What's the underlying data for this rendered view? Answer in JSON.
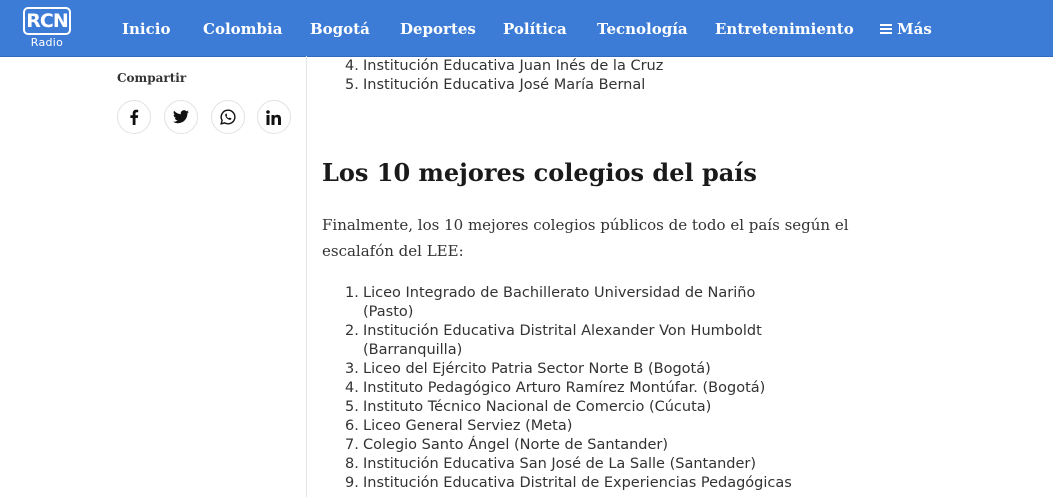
{
  "header": {
    "logo_mark": "RCN",
    "logo_text": "Radio",
    "nav": [
      {
        "label": "Inicio"
      },
      {
        "label": "Colombia"
      },
      {
        "label": "Bogotá"
      },
      {
        "label": "Deportes"
      },
      {
        "label": "Política"
      },
      {
        "label": "Tecnología"
      },
      {
        "label": "Entretenimiento"
      },
      {
        "label": "Más"
      }
    ]
  },
  "sidebar": {
    "share_label": "Compartir",
    "share_buttons": [
      "facebook-icon",
      "twitter-icon",
      "whatsapp-icon",
      "linkedin-icon"
    ]
  },
  "article": {
    "previous_list": [
      {
        "num": "4.",
        "text": "Institución Educativa Juan Inés de la Cruz"
      },
      {
        "num": "5.",
        "text": "Institución Educativa José María Bernal"
      }
    ],
    "heading": "Los 10 mejores colegios del país",
    "paragraph": "Finalmente, los 10 mejores colegios públicos de todo el país según el escalafón del LEE:",
    "top10": [
      {
        "num": "1.",
        "line1": "Liceo Integrado de Bachillerato Universidad de Nariño",
        "line2": "(Pasto)"
      },
      {
        "num": "2.",
        "line1": "Institución Educativa Distrital Alexander Von Humboldt",
        "line2": "(Barranquilla)"
      },
      {
        "num": "3.",
        "line1": "Liceo del Ejército Patria Sector Norte B (Bogotá)",
        "line2": ""
      },
      {
        "num": "4.",
        "line1": "Instituto Pedagógico Arturo Ramírez Montúfar. (Bogotá)",
        "line2": ""
      },
      {
        "num": "5.",
        "line1": "Instituto Técnico Nacional de Comercio (Cúcuta)",
        "line2": ""
      },
      {
        "num": "6.",
        "line1": "Liceo General Serviez (Meta)",
        "line2": ""
      },
      {
        "num": "7.",
        "line1": "Colegio Santo Ángel (Norte de Santander)",
        "line2": ""
      },
      {
        "num": "8.",
        "line1": "Institución Educativa San José de La Salle (Santander)",
        "line2": ""
      },
      {
        "num": "9.",
        "line1": "Institución Educativa Distrital de Experiencias Pedagógicas",
        "line2": ""
      }
    ]
  },
  "colors": {
    "brand_blue": "#3d7cd6",
    "text": "#333333"
  }
}
